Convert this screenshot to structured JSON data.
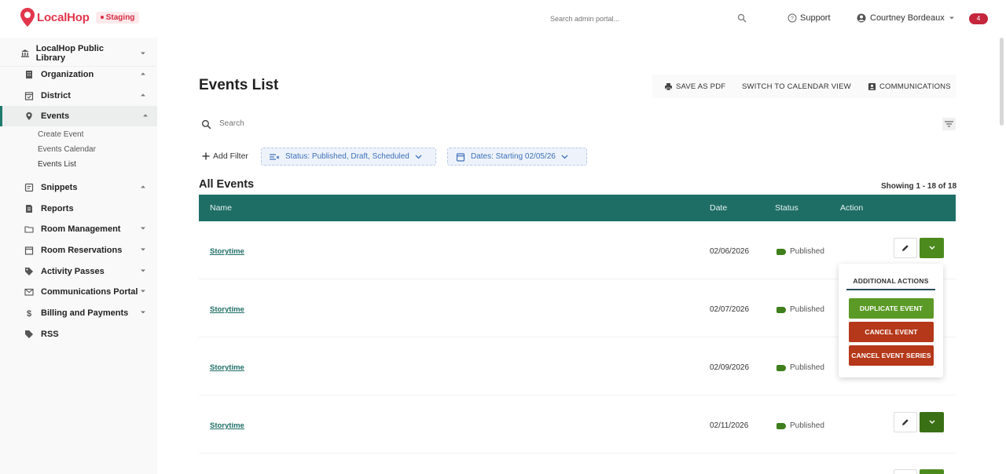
{
  "colors": {
    "brand": "#e2364c",
    "teal": "#1e6e66",
    "green": "#4c8a1e",
    "red": "#b5381a",
    "status_tag": "#3f7f1c"
  },
  "header": {
    "logo": "LocalHop",
    "env_badge": "Staging",
    "search_placeholder": "Search admin portal...",
    "support": "Support",
    "user_name": "Courtney Bordeaux",
    "notifications": "4"
  },
  "sidebar": {
    "library": "LocalHop Public Library",
    "items": [
      {
        "label": "Organization",
        "icon": "building-icon"
      },
      {
        "label": "District",
        "icon": "calendar-check-icon"
      },
      {
        "label": "Events",
        "icon": "pin-icon"
      },
      {
        "label": "Snippets",
        "icon": "snippet-icon"
      },
      {
        "label": "Reports",
        "icon": "report-icon"
      },
      {
        "label": "Room Management",
        "icon": "folder-icon"
      },
      {
        "label": "Room Reservations",
        "icon": "calendar-icon"
      },
      {
        "label": "Activity Passes",
        "icon": "tag-icon"
      },
      {
        "label": "Communications Portal",
        "icon": "email-icon"
      },
      {
        "label": "Billing and Payments",
        "icon": "dollar-icon"
      },
      {
        "label": "RSS",
        "icon": "rss-icon"
      }
    ],
    "sub_items": [
      "Create Event",
      "Events Calendar",
      "Events List"
    ]
  },
  "main": {
    "title": "Events List",
    "toolbar": {
      "save_pdf": "SAVE AS PDF",
      "calendar_view": "SWITCH TO CALENDAR VIEW",
      "communications": "COMMUNICATIONS"
    },
    "search_placeholder": "Search",
    "add_filter": "Add Filter",
    "status_chip": "Status: Published, Draft, Scheduled",
    "dates_chip": "Dates: Starting 02/05/26",
    "section_title": "All Events",
    "showing": "Showing 1 - 18 of 18",
    "columns": {
      "name": "Name",
      "date": "Date",
      "status": "Status",
      "action": "Action"
    },
    "rows": [
      {
        "name": "Storytime",
        "date": "02/06/2026",
        "status": "Published"
      },
      {
        "name": "Storytime",
        "date": "02/07/2026",
        "status": "Published"
      },
      {
        "name": "Storytime",
        "date": "02/09/2026",
        "status": "Published"
      },
      {
        "name": "Storytime",
        "date": "02/11/2026",
        "status": "Published"
      }
    ]
  },
  "dropdown": {
    "header": "ADDITIONAL ACTIONS",
    "duplicate": "DUPLICATE EVENT",
    "cancel": "CANCEL EVENT",
    "cancel_series": "CANCEL EVENT SERIES"
  }
}
